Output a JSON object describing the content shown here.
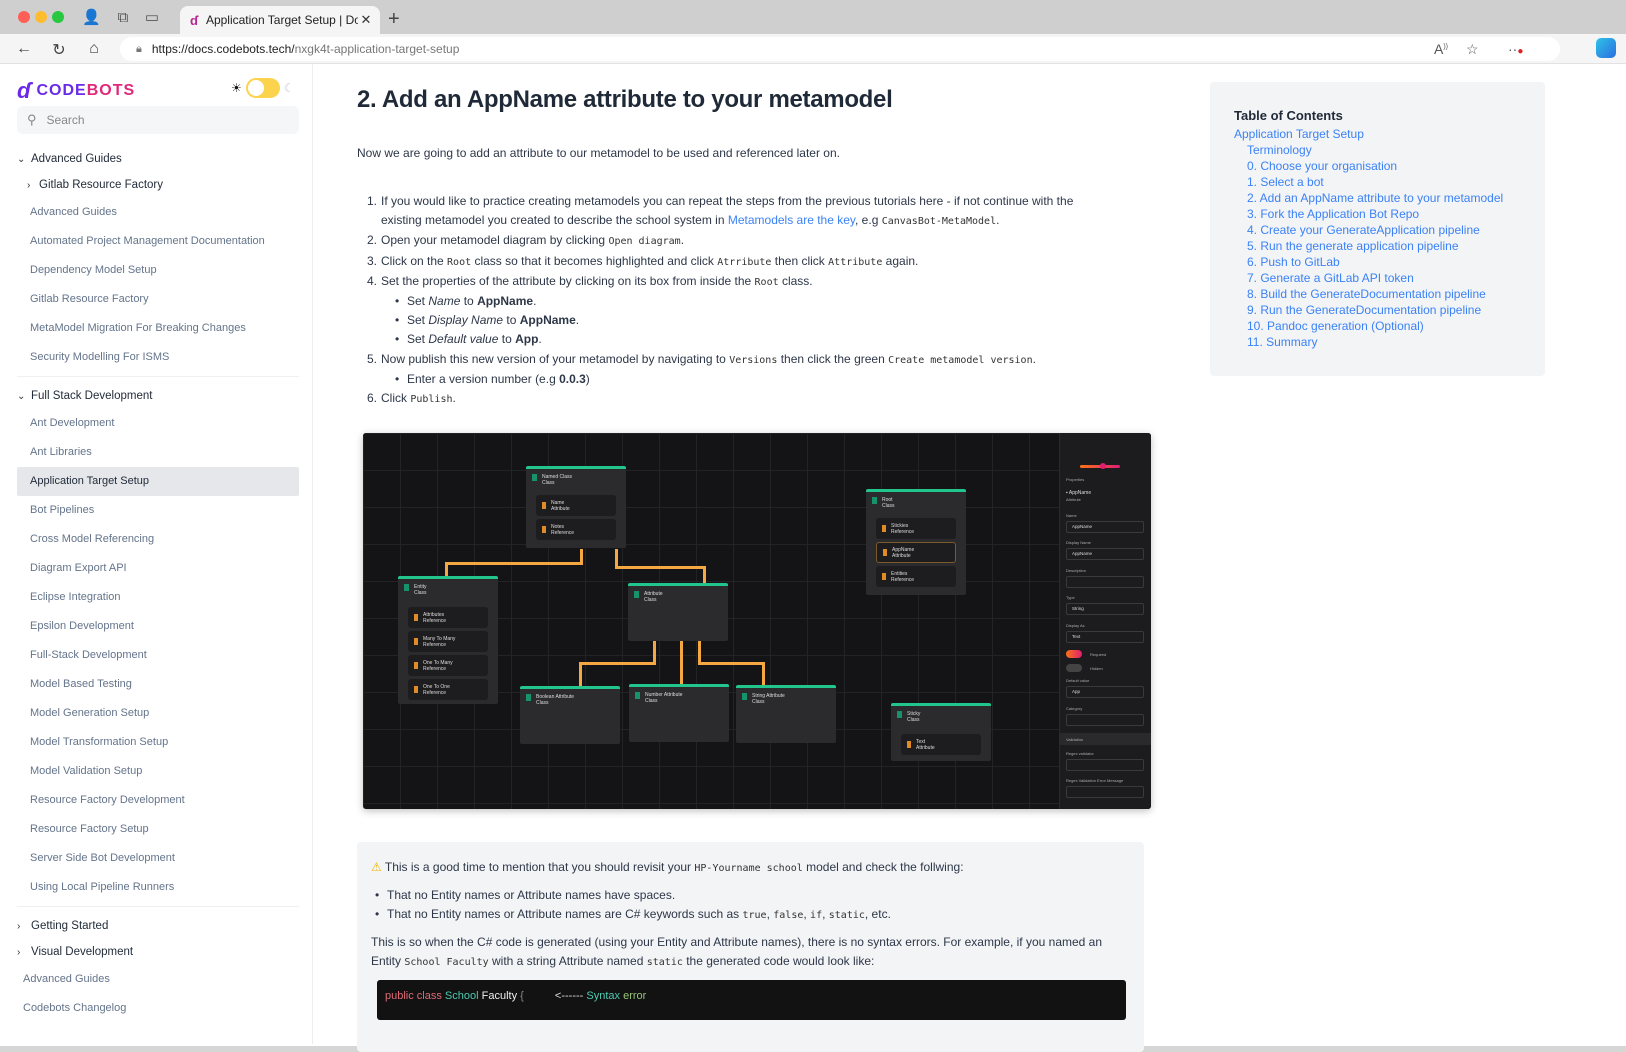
{
  "browser": {
    "tab_title": "Application Target Setup | Docs",
    "tab_logo": "ɗ",
    "url_host": "https://docs.codebots.tech/",
    "url_path": "nxgk4t-application-target-setup",
    "icons": [
      "back-icon",
      "reload-icon",
      "home-icon",
      "lock-icon",
      "read-aloud-icon",
      "star-icon",
      "more-icon",
      "copilot-icon"
    ]
  },
  "sidebar": {
    "brand_code": "CODE",
    "brand_bots": "BOTS",
    "search_placeholder": "Search",
    "theme": "light",
    "sections": [
      {
        "label": "Advanced Guides",
        "expanded": true,
        "subcats": [
          {
            "label": "Gitlab Resource Factory"
          }
        ],
        "items": [
          "Advanced Guides",
          "Automated Project Management Documentation",
          "Dependency Model Setup",
          "Gitlab Resource Factory",
          "MetaModel Migration For Breaking Changes",
          "Security Modelling For ISMS"
        ]
      },
      {
        "label": "Full Stack Development",
        "expanded": true,
        "items": [
          "Ant Development",
          "Ant Libraries",
          "Application Target Setup",
          "Bot Pipelines",
          "Cross Model Referencing",
          "Diagram Export API",
          "Eclipse Integration",
          "Epsilon Development",
          "Full-Stack Development",
          "Model Based Testing",
          "Model Generation Setup",
          "Model Transformation Setup",
          "Model Validation Setup",
          "Resource Factory Development",
          "Resource Factory Setup",
          "Server Side Bot Development",
          "Using Local Pipeline Runners"
        ]
      },
      {
        "label": "Getting Started",
        "expanded": false
      },
      {
        "label": "Visual Development",
        "expanded": false
      }
    ],
    "active_item": "Application Target Setup",
    "top_items": [
      "Advanced Guides",
      "Codebots Changelog"
    ]
  },
  "main": {
    "heading": "2. Add an AppName attribute to your metamodel",
    "intro": "Now we are going to add an attribute to our metamodel to be used and referenced later on.",
    "steps": {
      "s1a": "If you would like to practice creating metamodels you can repeat the steps from the previous tutorials here - if not continue with the",
      "s1b": "existing metamodel you created to describe the school system in ",
      "s1_link": "Metamodels are the key",
      "s1c": ", e.g ",
      "s1_code": "CanvasBot-MetaModel",
      "s2a": "Open your metamodel diagram by clicking ",
      "s2_code": "Open diagram",
      "s3a": "Click on the ",
      "s3_code1": "Root",
      "s3b": " class so that it becomes highlighted and click ",
      "s3_code2": "Atrribute",
      "s3c": " then click ",
      "s3_code3": "Attribute",
      "s3d": " again.",
      "s4a": "Set the properties of the attribute by clicking on its box from inside the ",
      "s4_code": "Root",
      "s4b": " class.",
      "s4_sub": [
        {
          "pre": "Set ",
          "em": "Name",
          "mid": " to ",
          "strong": "AppName"
        },
        {
          "pre": "Set ",
          "em": "Display Name",
          "mid": " to ",
          "strong": "AppName"
        },
        {
          "pre": "Set ",
          "em": "Default value",
          "mid": " to ",
          "strong": "App"
        }
      ],
      "s5a": "Now publish this new version of your metamodel by navigating to ",
      "s5_code1": "Versions",
      "s5b": " then click the green ",
      "s5_code2": "Create metamodel version",
      "s5_sub_pre": "Enter a version number (e.g ",
      "s5_sub_strong": "0.0.3",
      "s5_sub_post": ")",
      "s6a": "Click ",
      "s6_code": "Publish"
    },
    "diagram": {
      "nodes": {
        "named_class": {
          "name": "Named Class",
          "type": "Class",
          "attrs": [
            [
              "Name",
              "Attribute"
            ],
            [
              "Notes",
              "Reference"
            ]
          ]
        },
        "entity": {
          "name": "Entity",
          "type": "Class",
          "attrs": [
            [
              "Attributes",
              "Reference"
            ],
            [
              "Many To Many",
              "Reference"
            ],
            [
              "One To Many",
              "Reference"
            ],
            [
              "One To One",
              "Reference"
            ]
          ]
        },
        "attribute": {
          "name": "Attribute",
          "type": "Class"
        },
        "boolean": {
          "name": "Boolean Attribute",
          "type": "Class"
        },
        "number": {
          "name": "Number Attribute",
          "type": "Class"
        },
        "string": {
          "name": "String Attribute",
          "type": "Class"
        },
        "root": {
          "name": "Root",
          "type": "Class",
          "attrs": [
            [
              "Stickies",
              "Reference"
            ],
            [
              "AppName",
              "Attribute"
            ],
            [
              "Entities",
              "Reference"
            ]
          ]
        },
        "sticky": {
          "name": "Sticky",
          "type": "Class",
          "attrs": [
            [
              "Text",
              "Attribute"
            ]
          ]
        }
      },
      "panel": {
        "title": "Properties",
        "selected": "AppName",
        "selected_type": "Attribute",
        "name_label": "Name",
        "name_value": "AppName",
        "display_label": "Display Name",
        "display_value": "AppName",
        "desc_label": "Description",
        "type_label": "Type",
        "type_value": "String",
        "display_as_label": "Display As",
        "display_as_value": "Text",
        "required_label": "Required",
        "required": true,
        "hidden_label": "Hidden",
        "hidden": false,
        "default_label": "Default value",
        "default_value": "App",
        "category_label": "Category",
        "validation_label": "Validation",
        "regex_label": "Regex validator",
        "regex_err_label": "Regex Validation Error Message"
      }
    },
    "note": {
      "warn_pre": "This is a good time to mention that you should revisit your ",
      "warn_code": "HP-Yourname school",
      "warn_post": " model and check the follwing:",
      "b1": "That no Entity names or Attribute names have spaces.",
      "b2_pre": "That no Entity names or Attribute names are C# keywords such as ",
      "b2_codes": [
        "true",
        "false",
        "if",
        "static"
      ],
      "b2_post": ", etc.",
      "p1": "This is so when the C# code is generated (using your Entity and Attribute names), there is no syntax errors. For example, if you named an",
      "p2_pre": "Entity ",
      "p2_code1": "School Faculty",
      "p2_mid": " with a string Attribute named ",
      "p2_code2": "static",
      "p2_post": " the generated code would look like:",
      "code": {
        "kw": "public class",
        "cls1": "School",
        "cls2": "Faculty",
        "brace": "{",
        "arrow": "<------",
        "err1": "Syntax",
        "err2": "error"
      }
    }
  },
  "toc": {
    "title": "Table of Contents",
    "root": "Application Target Setup",
    "items": [
      "Terminology",
      "0. Choose your organisation",
      "1. Select a bot",
      "2. Add an AppName attribute to your metamodel",
      "3. Fork the Application Bot Repo",
      "4. Create your GenerateApplication pipeline",
      "5. Run the generate application pipeline",
      "6. Push to GitLab",
      "7. Generate a GitLab API token",
      "8. Build the GenerateDocumentation pipeline",
      "9. Run the GenerateDocumentation pipeline",
      "10. Pandoc generation (Optional)",
      "11. Summary"
    ]
  }
}
